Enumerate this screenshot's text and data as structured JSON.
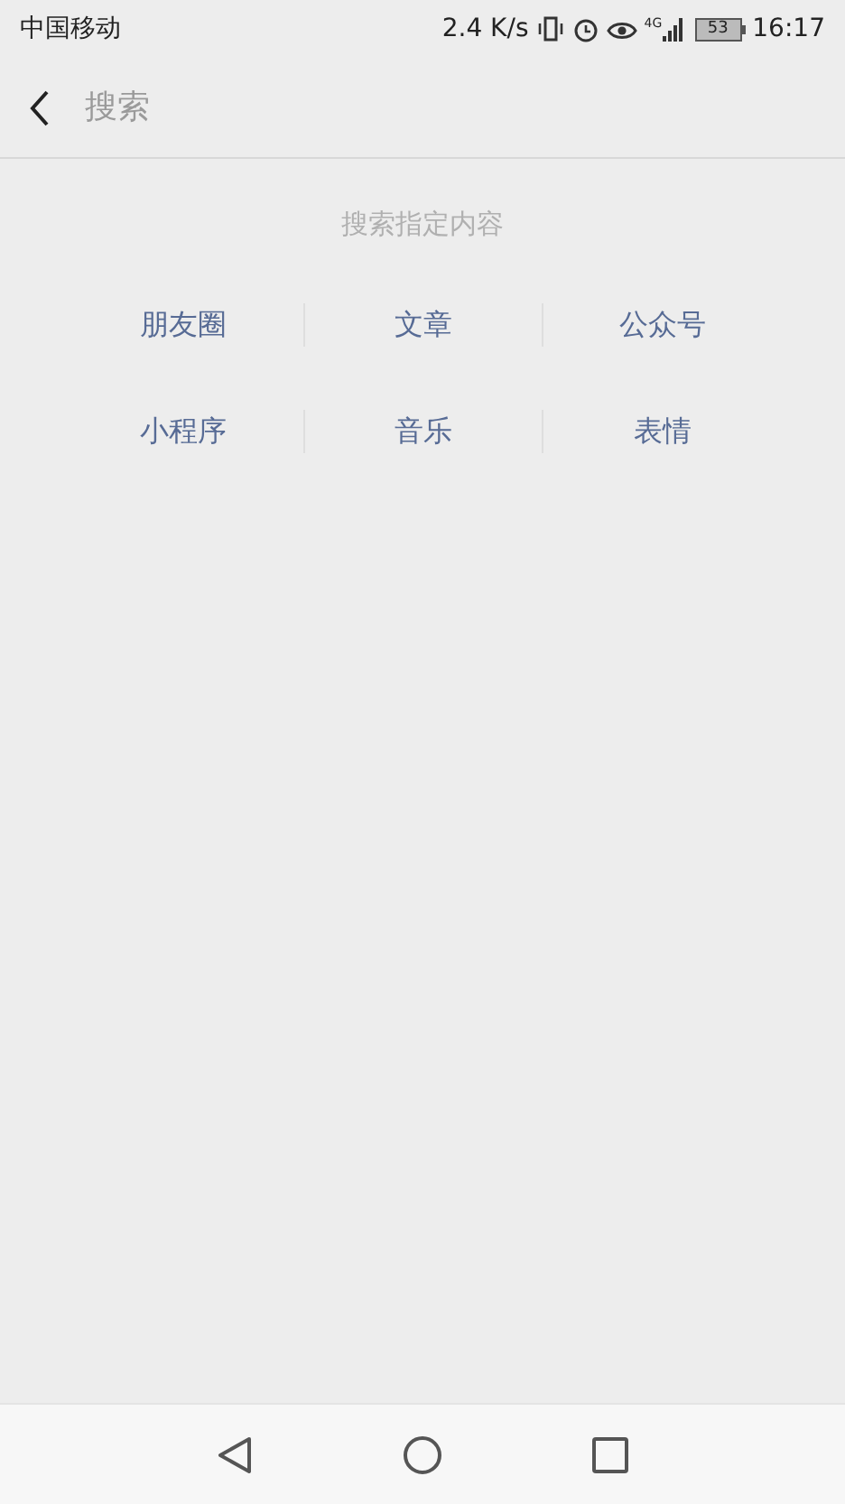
{
  "status_bar": {
    "carrier": "中国移动",
    "speed": "2.4 K/s",
    "network": "4G",
    "battery": "53",
    "time": "16:17"
  },
  "search": {
    "placeholder": "搜索"
  },
  "hint": "搜索指定内容",
  "categories": [
    [
      "朋友圈",
      "文章",
      "公众号"
    ],
    [
      "小程序",
      "音乐",
      "表情"
    ]
  ]
}
